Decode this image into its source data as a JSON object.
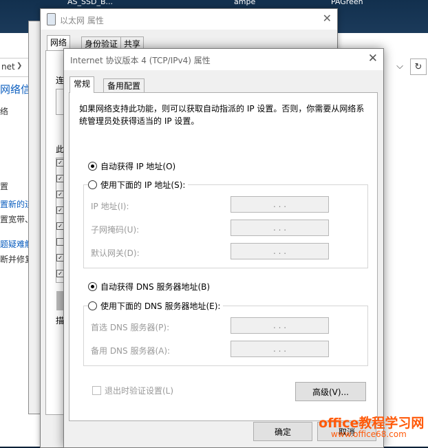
{
  "desktop": {
    "labels": [
      "AS_SSD_B...",
      "ampe",
      "PAGreen"
    ]
  },
  "explorer": {
    "addr_text": "net",
    "addr_chevron": "❯",
    "partial_lines": [
      "网络信",
      "络",
      "置",
      "置新的连",
      "置宽带、",
      "题疑难解",
      "断并修复"
    ],
    "dropdown_icon": "⌵",
    "refresh_icon": "↻"
  },
  "ethernet_window": {
    "title": "以太网 属性",
    "close_icon": "✕",
    "tabs": [
      "网络",
      "身份验证",
      "共享"
    ],
    "partial_connect": "连",
    "partial_items": "此",
    "partial_label": "描"
  },
  "dialog": {
    "title": "Internet 协议版本 4 (TCP/IPv4) 属性",
    "close_icon": "✕",
    "tabs": [
      "常规",
      "备用配置"
    ],
    "description": "如果网络支持此功能，则可以获取自动指派的 IP 设置。否则，你需要从网络系统管理员处获得适当的 IP 设置。",
    "ip_auto_label": "自动获得 IP 地址(O)",
    "ip_manual_label": "使用下面的 IP 地址(S):",
    "ip_fields": [
      {
        "label": "IP 地址(I):",
        "value": ". . ."
      },
      {
        "label": "子网掩码(U):",
        "value": ". . ."
      },
      {
        "label": "默认网关(D):",
        "value": ". . ."
      }
    ],
    "dns_auto_label": "自动获得 DNS 服务器地址(B)",
    "dns_manual_label": "使用下面的 DNS 服务器地址(E):",
    "dns_fields": [
      {
        "label": "首选 DNS 服务器(P):",
        "value": ". . ."
      },
      {
        "label": "备用 DNS 服务器(A):",
        "value": ". . ."
      }
    ],
    "validate_label": "退出时验证设置(L)",
    "advanced_label": "高级(V)...",
    "ok_label": "确定",
    "cancel_label": "取消",
    "ip_auto_selected": true,
    "dns_auto_selected": true,
    "validate_checked": false
  },
  "watermark": {
    "brand": "office教程学习网",
    "url": "www.office68.com"
  }
}
